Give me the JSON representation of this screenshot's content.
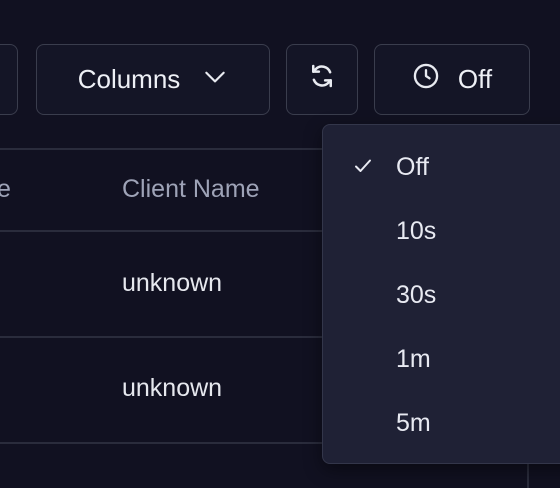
{
  "toolbar": {
    "columns_label": "Columns",
    "auto_refresh_label": "Off"
  },
  "table": {
    "headers": [
      "e",
      "Client Name"
    ],
    "rows": [
      {
        "client_name": "unknown"
      },
      {
        "client_name": "unknown"
      }
    ]
  },
  "refresh_menu": {
    "selected": "Off",
    "options": [
      "Off",
      "10s",
      "30s",
      "1m",
      "5m"
    ]
  },
  "icons": [
    "chevron-down-icon",
    "refresh-icon",
    "clock-icon",
    "check-icon"
  ],
  "colors": {
    "background": "#111121",
    "menu_background": "#1f2135",
    "border": "#3a3d4d",
    "header_text": "#9ea3b7"
  }
}
